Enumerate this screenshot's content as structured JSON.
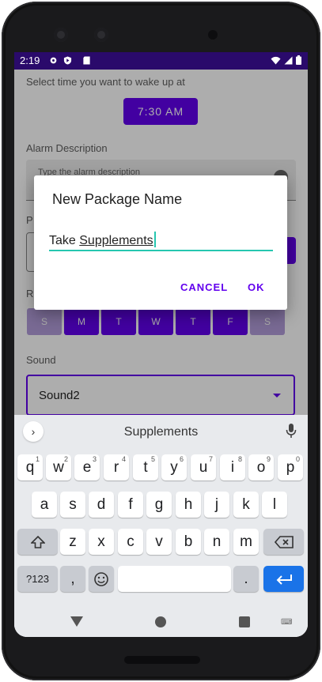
{
  "status_bar": {
    "time": "2:19",
    "left_icons": [
      "settings-icon",
      "shield-play-icon",
      "sd-card-icon"
    ],
    "right_icons": [
      "wifi-icon",
      "signal-icon",
      "battery-icon"
    ],
    "color": "#2a0a6b"
  },
  "app": {
    "wake_label": "Select time you want to wake up at",
    "time_value": "7:30  AM",
    "description_label": "Alarm Description",
    "description_placeholder": "Type the alarm description",
    "package_label_partial": "P",
    "repeat_label_partial": "R",
    "days": [
      {
        "label": "S",
        "selected": false
      },
      {
        "label": "M",
        "selected": true
      },
      {
        "label": "T",
        "selected": true
      },
      {
        "label": "W",
        "selected": true
      },
      {
        "label": "T",
        "selected": true
      },
      {
        "label": "F",
        "selected": true
      },
      {
        "label": "S",
        "selected": false
      }
    ],
    "sound_label": "Sound",
    "sound_value": "Sound2",
    "accent": "#6200ee"
  },
  "dialog": {
    "title": "New Package Name",
    "input_prefix": "Take ",
    "input_composing": "Supplements",
    "cancel_label": "CANCEL",
    "ok_label": "OK",
    "focus_color": "#26c6b0"
  },
  "keyboard": {
    "suggestion": "Supplements",
    "row1": [
      {
        "k": "q",
        "h": "1"
      },
      {
        "k": "w",
        "h": "2"
      },
      {
        "k": "e",
        "h": "3"
      },
      {
        "k": "r",
        "h": "4"
      },
      {
        "k": "t",
        "h": "5"
      },
      {
        "k": "y",
        "h": "6"
      },
      {
        "k": "u",
        "h": "7"
      },
      {
        "k": "i",
        "h": "8"
      },
      {
        "k": "o",
        "h": "9"
      },
      {
        "k": "p",
        "h": "0"
      }
    ],
    "row2": [
      "a",
      "s",
      "d",
      "f",
      "g",
      "h",
      "j",
      "k",
      "l"
    ],
    "row3": [
      "z",
      "x",
      "c",
      "v",
      "b",
      "n",
      "m"
    ],
    "symbols_label": "?123",
    "comma_label": ",",
    "period_label": ".",
    "enter_color": "#1a73e8"
  },
  "nav": {
    "icons": [
      "back-icon",
      "home-icon",
      "recents-icon",
      "keyboard-switch-icon"
    ]
  }
}
